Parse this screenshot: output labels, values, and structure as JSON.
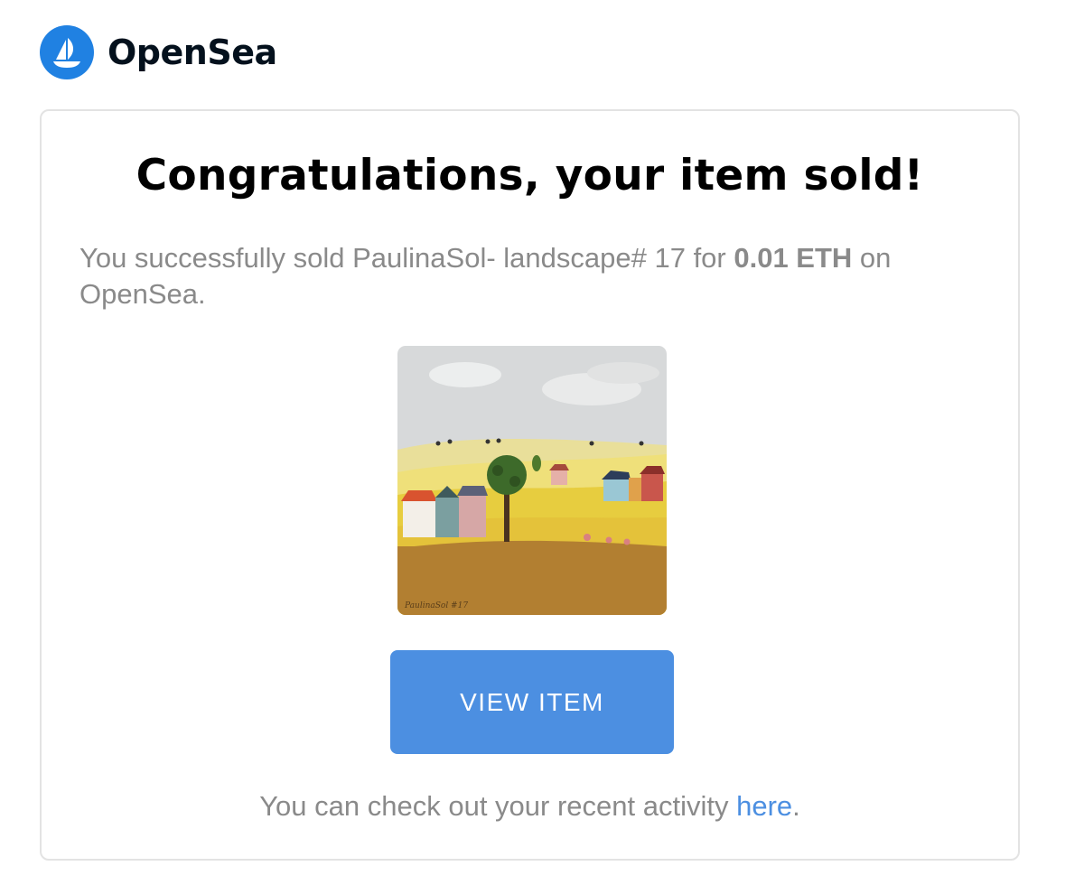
{
  "header": {
    "logo_icon": "opensea-ship-icon",
    "brand_name": "OpenSea",
    "brand_color": "#2081E2"
  },
  "card": {
    "title": "Congratulations, your item sold!",
    "message_before": "You successfully sold PaulinaSol- landscape# 17 for ",
    "price": "0.01 ETH",
    "message_after": " on OpenSea.",
    "image": {
      "alt": "PaulinaSol- landscape# 17",
      "signature": "PaulinaSol #17"
    },
    "view_button_label": "VIEW ITEM",
    "footer_before": "You can check out your recent activity ",
    "footer_link": "here",
    "footer_after": ".",
    "accent_color": "#4C8FE1"
  }
}
